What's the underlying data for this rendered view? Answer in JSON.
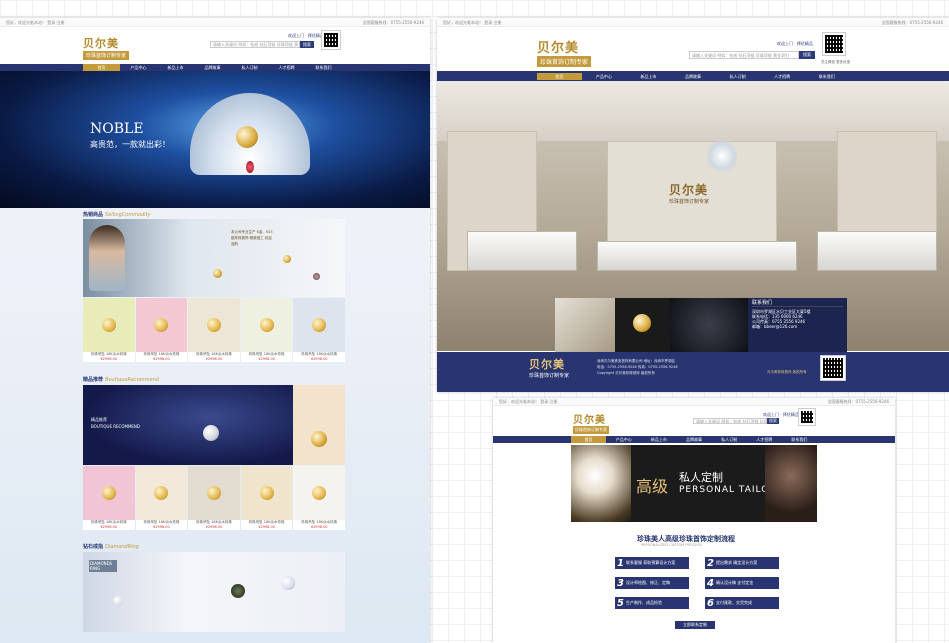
{
  "colors": {
    "navy": "#283570",
    "gold": "#c39b3c"
  },
  "common": {
    "topbar_left": "您好，欢迎光临本站！  登录  注册",
    "topbar_right": "全国客服热线：0755-2556-9246",
    "logo_cn": "贝尔美",
    "logo_sub": "珍珠首饰订制专家",
    "search_placeholder": "请输入关键词 例如：钻戒 钻石项链 珍珠项链 黄金耳钉",
    "search_btn": "搜索",
    "hot_text": "欢迎上门 · 择优精品",
    "qr_caption": "关注微信 更多优惠",
    "nav": [
      "首页",
      "产品中心",
      "新品上市",
      "品牌故事",
      "私人订制",
      "人才招聘",
      "联系我们"
    ]
  },
  "panelA": {
    "banner_big": "NOBLE",
    "banner_small": "高贵范，一款就出彩！",
    "sec1_title": "热销商品",
    "sec1_en": "SellingCommodity",
    "promo_text": "本公司专业生产 K金、925银珍珠首饰 精致做工 欢迎选购",
    "sec2_title": "精品推荐",
    "sec2_en": "BoutiqueRecommend",
    "boutique_cn": "精品推荐",
    "boutique_en": "BOUTIQUE RECOMMEND",
    "sec3_title": "钻石戒指",
    "sec3_en": "DiamondRing",
    "diamond_label": "DIAMONDS RING",
    "items": [
      {
        "name": "珍珠吊坠 18K淡水珍珠",
        "price": "¥2998.00"
      },
      {
        "name": "珍珠吊坠 18K淡水珍珠",
        "price": "¥2998.00"
      },
      {
        "name": "珍珠吊坠 18K淡水珍珠",
        "price": "¥2998.00"
      },
      {
        "name": "珍珠吊坠 18K淡水珍珠",
        "price": "¥2998.00"
      },
      {
        "name": "珍珠吊坠 18K淡水珍珠",
        "price": "¥2998.00"
      }
    ]
  },
  "panelB": {
    "contact_title": "联系我们",
    "contact_lines": [
      "深圳市罗湖区水贝工业区大厦5楼",
      "联系电话：135 0000 6246",
      "公司传真：0755 2556 9246",
      "邮箱：bbeer@126.com"
    ],
    "footer_lines": [
      "深圳贝尔美珠宝首饰有限公司 地址：深圳市罗湖区",
      "电话：0755-2556-9246 传真：0755-2556-9246",
      "Copyright 贝尔美珍珠首饰 版权所有"
    ],
    "footer_link": "贝尔美珍珠首饰 版权所有"
  },
  "panelC": {
    "banner_t1": "高级",
    "banner_t2": "私人定制",
    "banner_t3": "PERSONAL TAILOR",
    "proc_title": "珍珠美人高级珍珠首饰定制流程",
    "proc_sub": "PERSONALIZED CUSTOM PROCESS",
    "steps": [
      {
        "n": "1",
        "text": "联系客服 获取预算设计方案"
      },
      {
        "n": "2",
        "text": "提出需求 确定设计方案"
      },
      {
        "n": "3",
        "text": "设计师绘图、修正、定稿"
      },
      {
        "n": "4",
        "text": "确认设计稿 支付定金"
      },
      {
        "n": "5",
        "text": "生产制作、成品检验"
      },
      {
        "n": "6",
        "text": "支付尾款、交货完成"
      }
    ],
    "cta": "立即联系定制"
  }
}
